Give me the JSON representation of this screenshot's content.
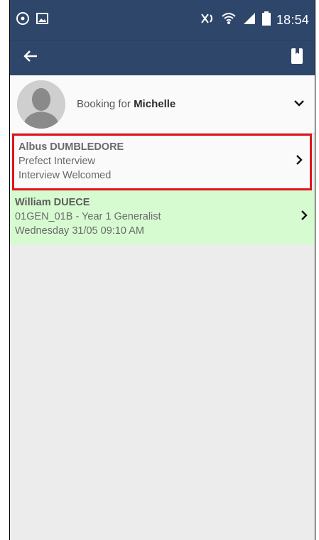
{
  "status_bar": {
    "time": "18:54"
  },
  "booking": {
    "prefix": "Booking for",
    "name": "Michelle"
  },
  "items": [
    {
      "name": "Albus DUMBLEDORE",
      "line1": "Prefect Interview",
      "line2": "Interview Welcomed"
    },
    {
      "name": "William DUECE",
      "line1": "01GEN_01B - Year 1 Generalist",
      "line2": "Wednesday 31/05 09:10 AM"
    }
  ],
  "colors": {
    "header": "#2f466b",
    "highlight_border": "#e0141d",
    "confirmed_row": "#d7fbd0",
    "background": "#ececec"
  },
  "icons": [
    "sync-icon",
    "screenshot-icon",
    "mute-icon",
    "wifi-icon",
    "signal-icon",
    "battery-icon",
    "back-arrow-icon",
    "book-icon",
    "chevron-down-icon",
    "chevron-right-icon"
  ]
}
